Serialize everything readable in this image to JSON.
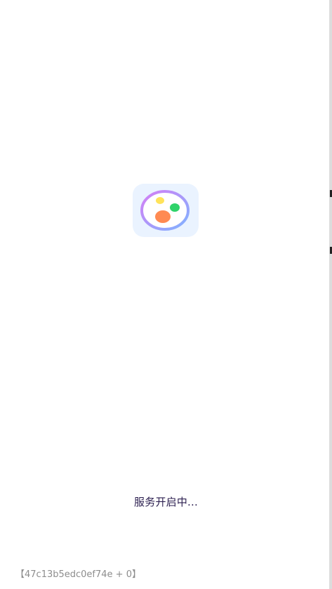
{
  "status": {
    "message": "服务开启中..."
  },
  "footer": {
    "build_id": "【47c13b5edc0ef74e + 0】"
  },
  "icon": {
    "name": "app-logo-icon",
    "colors": {
      "background": "#eaf3ff",
      "ring_start": "#d57ef5",
      "ring_end": "#7fb3ff",
      "dot_yellow": "#ffe35a",
      "dot_green": "#2fd36a",
      "dot_orange": "#ff8a52"
    }
  }
}
